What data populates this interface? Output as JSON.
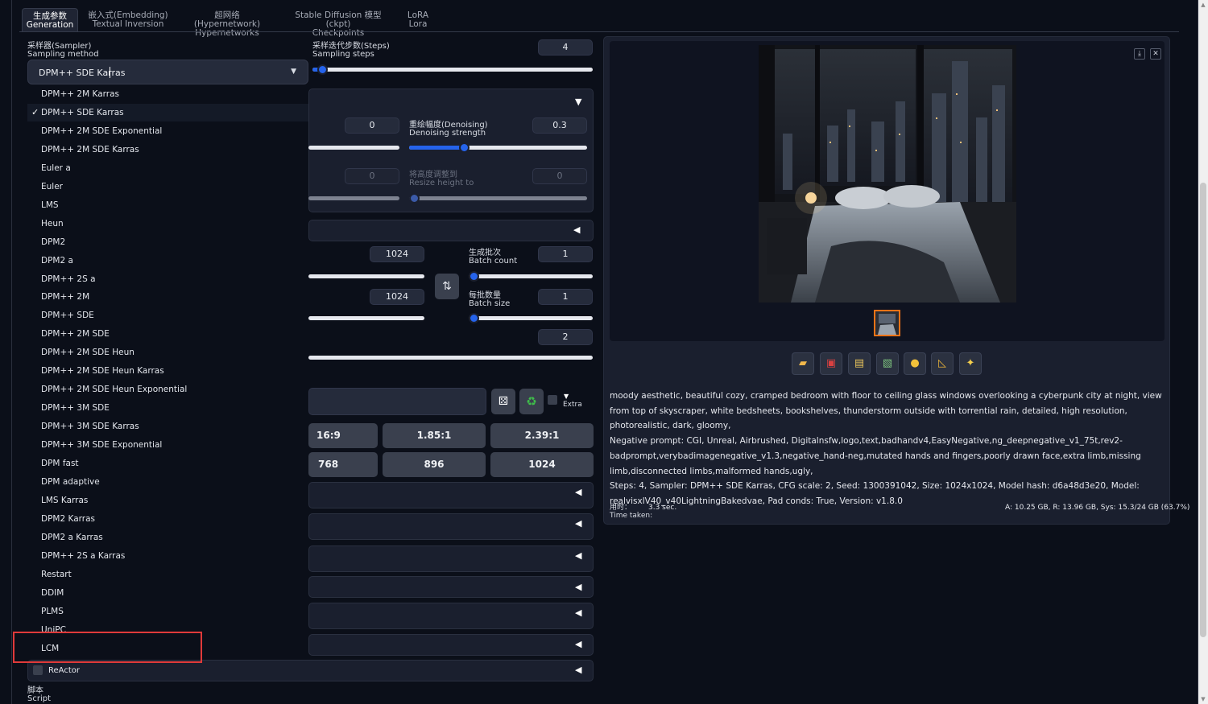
{
  "tabs": [
    {
      "zh": "生成参数",
      "en": "Generation"
    },
    {
      "zh": "嵌入式(Embedding)",
      "en": "Textual Inversion"
    },
    {
      "zh": "超网络(Hypernetwork)",
      "en": "Hypernetworks"
    },
    {
      "zh": "Stable Diffusion 模型(ckpt)",
      "en": "Checkpoints"
    },
    {
      "zh": "LoRA",
      "en": "Lora"
    }
  ],
  "sampler": {
    "label_zh": "采样器(Sampler)",
    "label_en": "Sampling method",
    "selected": "DPM++ SDE Karras",
    "options": [
      "DPM++ 2M Karras",
      "DPM++ SDE Karras",
      "DPM++ 2M SDE Exponential",
      "DPM++ 2M SDE Karras",
      "Euler a",
      "Euler",
      "LMS",
      "Heun",
      "DPM2",
      "DPM2 a",
      "DPM++ 2S a",
      "DPM++ 2M",
      "DPM++ SDE",
      "DPM++ 2M SDE",
      "DPM++ 2M SDE Heun",
      "DPM++ 2M SDE Heun Karras",
      "DPM++ 2M SDE Heun Exponential",
      "DPM++ 3M SDE",
      "DPM++ 3M SDE Karras",
      "DPM++ 3M SDE Exponential",
      "DPM fast",
      "DPM adaptive",
      "LMS Karras",
      "DPM2 Karras",
      "DPM2 a Karras",
      "DPM++ 2S a Karras",
      "Restart",
      "DDIM",
      "PLMS",
      "UniPC",
      "LCM"
    ]
  },
  "steps": {
    "label_zh": "采样迭代步数(Steps)",
    "label_en": "Sampling steps",
    "value": "4",
    "fraction": 0.03
  },
  "hires": {
    "left_value": "0",
    "denoise_label_zh": "重绘幅度(Denoising)",
    "denoise_label_en": "Denoising strength",
    "denoise_value": "0.3",
    "denoise_fraction": 0.3,
    "resize_left_value": "0",
    "resize_h_label_zh": "将高度调整到",
    "resize_h_label_en": "Resize height to",
    "resize_h_value": "0"
  },
  "size": {
    "width_value": "1024",
    "height_value": "1024",
    "swap_icon": "swap-vertical-icon",
    "batch_count_label_zh": "生成批次",
    "batch_count_label_en": "Batch count",
    "batch_count_value": "1",
    "batch_size_label_zh": "每批数量",
    "batch_size_label_en": "Batch size",
    "batch_size_value": "1",
    "cfg_value": "2"
  },
  "seed": {
    "extra_label": "Extra"
  },
  "ratios": {
    "row1": [
      "16:9",
      "1.85:1",
      "2.39:1"
    ],
    "row2": [
      "768",
      "896",
      "1024"
    ]
  },
  "reactor": {
    "label": "ReActor"
  },
  "script": {
    "label_zh": "脚本",
    "label_en": "Script"
  },
  "output": {
    "prompt": "moody aesthetic, beautiful cozy, cramped bedroom with floor to ceiling glass windows overlooking a cyberpunk city at night, view from top of skyscraper, white bedsheets, bookshelves, thunderstorm outside with torrential rain, detailed, high resolution, photorealistic, dark, gloomy,",
    "negative": "Negative prompt: CGI, Unreal, Airbrushed, Digitalnsfw,logo,text,badhandv4,EasyNegative,ng_deepnegative_v1_75t,rev2-badprompt,verybadimagenegative_v1.3,negative_hand-neg,mutated hands and fingers,poorly drawn face,extra limb,missing limb,disconnected limbs,malformed hands,ugly,",
    "params": "Steps: 4, Sampler: DPM++ SDE Karras, CFG scale: 2, Seed: 1300391042, Size: 1024x1024, Model hash: d6a48d3e20, Model: realvisxlV40_v40LightningBakedvae, Pad conds: True, Version: v1.8.0",
    "time_label_zh": "用时：",
    "time_label_en": "Time taken:",
    "time_value": "3.3 sec.",
    "mem_a": "A: 10.25 GB",
    "mem_r": "R: 13.96 GB",
    "mem_sys": "Sys: 15.3/24 GB (63.7%)",
    "toolbar_icons": [
      "folder-icon",
      "save-icon",
      "zip-icon",
      "send-to-img2img-icon",
      "send-to-inpaint-icon",
      "send-to-extras-icon",
      "sparkle-icon"
    ]
  },
  "colors": {
    "accent": "#2563eb",
    "highlight": "#e03a3a",
    "thumb_border": "#f97316"
  }
}
